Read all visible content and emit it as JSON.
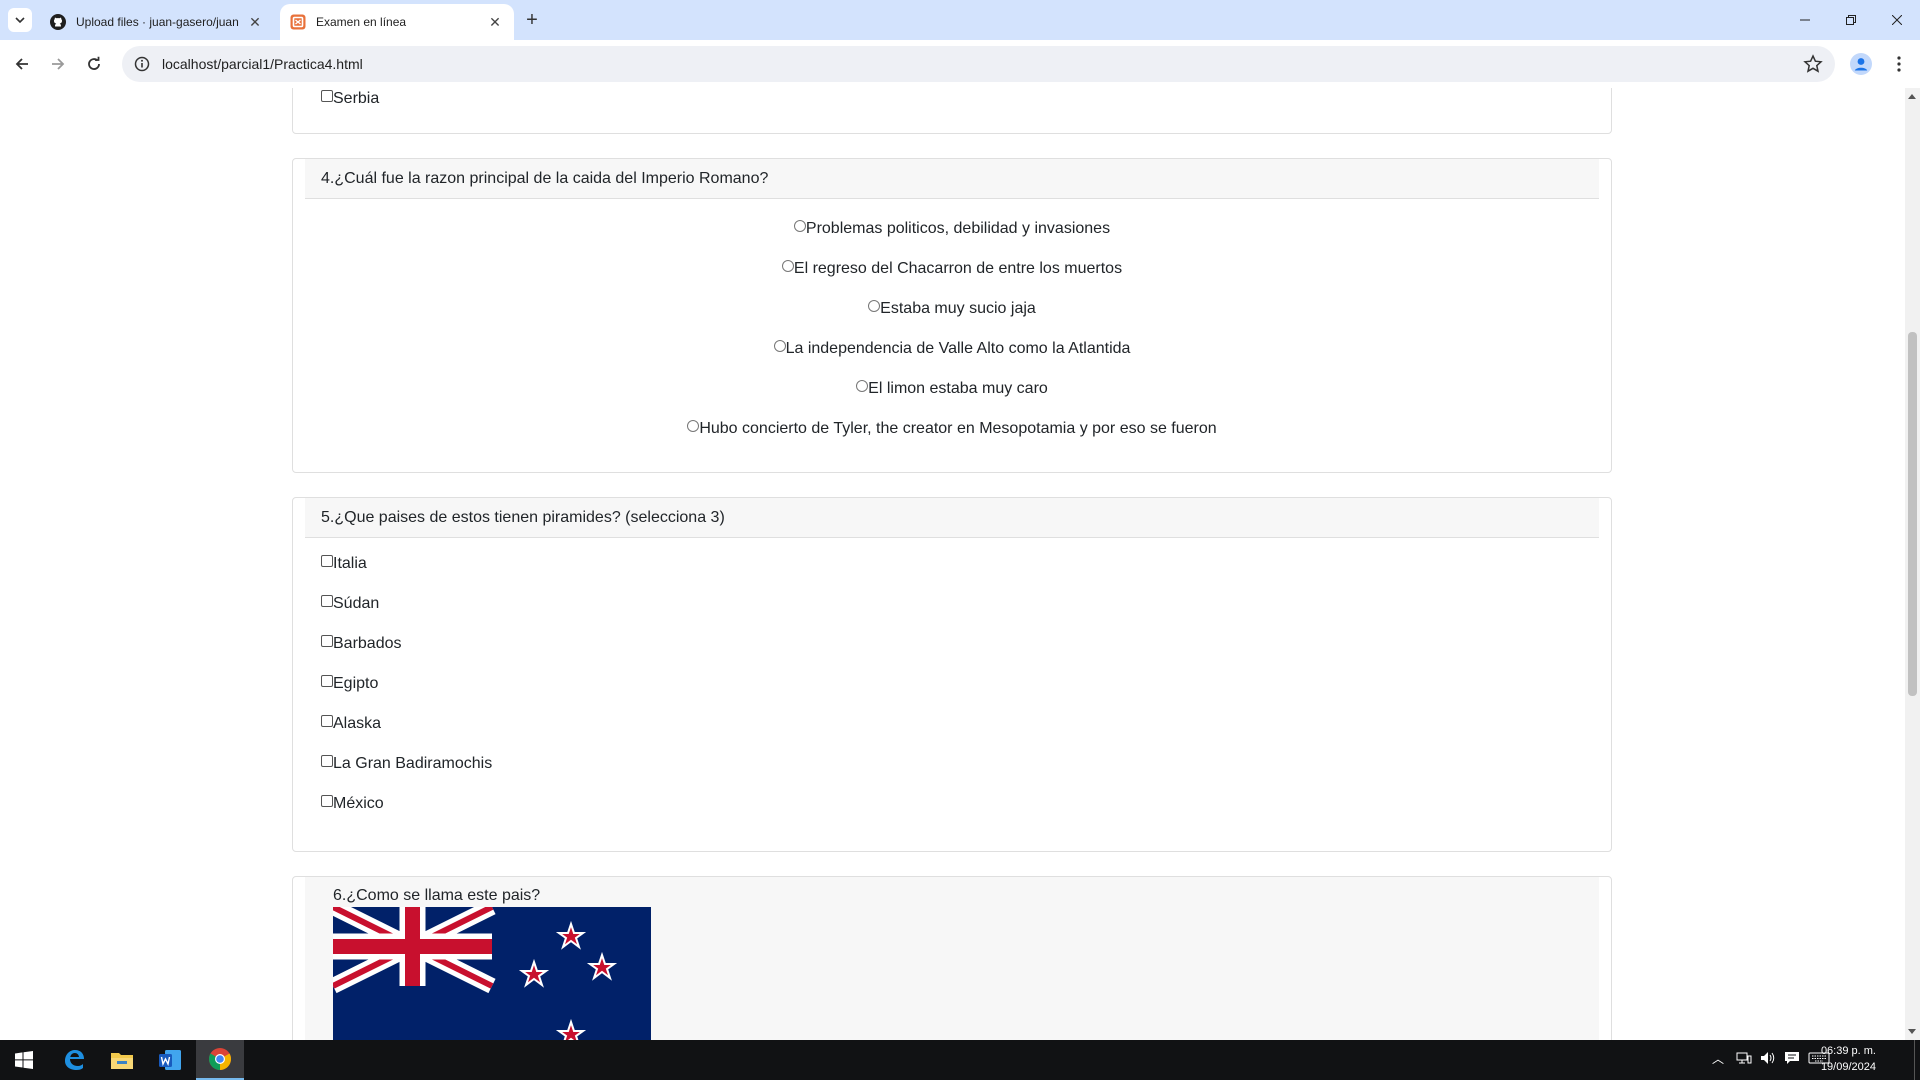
{
  "browser": {
    "tabs": [
      {
        "title": "Upload files · juan-gasero/juan",
        "icon": "github-icon",
        "active": false
      },
      {
        "title": "Examen en línea",
        "icon": "page-favicon",
        "active": true
      }
    ],
    "address": "localhost/parcial1/Practica4.html"
  },
  "quiz": {
    "prev_option": "Serbia",
    "q4": {
      "title": "4.¿Cuál fue la razon principal de la caida del Imperio Romano?",
      "options": [
        "Problemas politicos, debilidad y invasiones",
        "El regreso del Chacarron de entre los muertos",
        "Estaba muy sucio jaja",
        "La independencia de Valle Alto como la Atlantida",
        "El limon estaba muy caro",
        "Hubo concierto de Tyler, the creator en Mesopotamia y por eso se fueron"
      ]
    },
    "q5": {
      "title": "5.¿Que paises de estos tienen piramides? (selecciona 3)",
      "options": [
        "Italia",
        "Súdan",
        "Barbados",
        "Egipto",
        "Alaska",
        "La Gran Badiramochis",
        "México"
      ]
    },
    "q6": {
      "title": "6.¿Como se llama este pais?",
      "image": "new-zealand-flag"
    }
  },
  "taskbar": {
    "apps": [
      "windows-start-icon",
      "edge-icon",
      "file-explorer-icon",
      "word-icon",
      "chrome-icon"
    ],
    "clock": {
      "time": "06:39 p. m.",
      "date": "19/09/2024"
    }
  }
}
